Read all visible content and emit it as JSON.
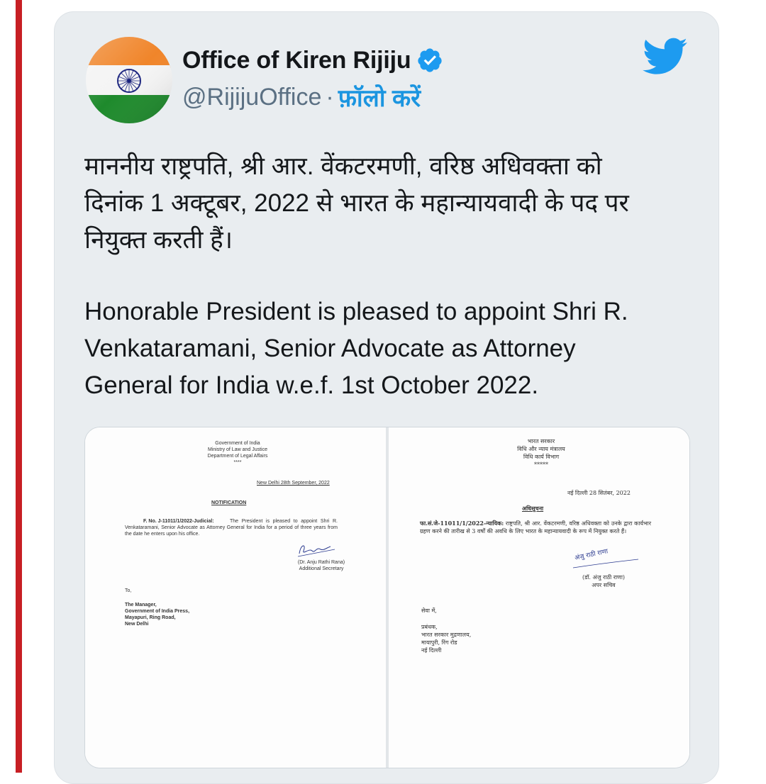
{
  "tweet": {
    "author_name": "Office of Kiren Rijiju",
    "handle": "@RijijuOffice",
    "separator": "·",
    "follow_label": "फ़ॉलो करें",
    "text_hindi_lines": [
      "माननीय राष्ट्रपति, श्री आर. वेंकटरमणी, वरिष्ठ अधिवक्ता को",
      "दिनांक 1 अक्टूबर, 2022 से भारत के महान्यायवादी के पद पर",
      "नियुक्त करती हैं।"
    ],
    "text_english_lines": [
      "Honorable President is pleased to appoint Shri R.",
      "Venkataramani, Senior Advocate as Attorney",
      "General for India w.e.f. 1st October 2022."
    ]
  },
  "icons": {
    "verified": "verified-badge-icon",
    "bird": "twitter-bird-icon"
  },
  "colors": {
    "accent": "#1b95e0",
    "card_bg": "#e9edf0",
    "left_bar": "#c71f24",
    "flag_saffron": "#ff9933",
    "flag_green": "#138808",
    "chakra": "#000080"
  },
  "documents": {
    "english": {
      "header": [
        "Government of India",
        "Ministry of Law and Justice",
        "Department of Legal Affairs",
        "****"
      ],
      "date": "New Delhi 28th September, 2022",
      "heading": "NOTIFICATION",
      "ref": "F. No. J-11011/1/2022-Judicial:",
      "body": "The President is pleased to appoint Shri R. Venkataramani, Senior Advocate as Attorney General for India for a period of three years from the date he enters upon his office.",
      "signatory": "(Dr. Anju Rathi Rana)",
      "designation": "Additional Secretary",
      "to": "To,",
      "address": [
        "The Manager,",
        "Government of India Press,",
        "Mayapuri, Ring Road,",
        "New Delhi"
      ]
    },
    "hindi": {
      "header": [
        "भारत सरकार",
        "विधि और न्याय मंत्रालय",
        "विधि कार्य विभाग",
        "*****"
      ],
      "date": "नई दिल्ली 28 सितंबर, 2022",
      "heading": "अधिसूचना",
      "ref": "फा.सं.जे-11011/1/2022-न्यायिक:",
      "body": "राष्ट्रपति, श्री आर. वेंकटरमणी, वरिष्ठ अधिवक्ता को उनके द्वारा कार्यभार ग्रहण करने की तारीख से 3 वर्षों की अवधि के लिए भारत के महान्यायवादी के रूप में नियुक्त करते हैं।",
      "signature_text": "अंजु राठी राणा",
      "signatory": "(डॉ. अंजु राठी राणा)",
      "designation": "अपर सचिव",
      "to": "सेवा में,",
      "address": [
        "प्रबंधक,",
        "भारत सरकार मुद्रणालय,",
        "मायापुरी, रिंग रोड",
        "नई दिल्ली"
      ]
    }
  }
}
